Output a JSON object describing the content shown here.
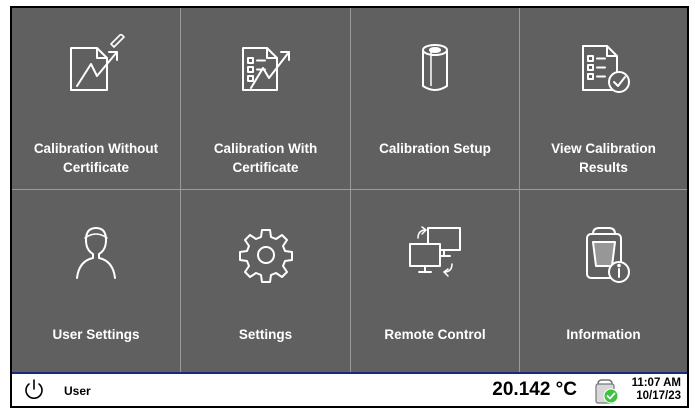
{
  "tiles": [
    {
      "label": "Calibration Without\nCertificate",
      "icon": "calibration-without-certificate-icon"
    },
    {
      "label": "Calibration With\nCertificate",
      "icon": "calibration-with-certificate-icon"
    },
    {
      "label": "Calibration Setup",
      "icon": "calibration-setup-icon"
    },
    {
      "label": "View Calibration\nResults",
      "icon": "view-calibration-results-icon"
    },
    {
      "label": "User Settings",
      "icon": "user-settings-icon"
    },
    {
      "label": "Settings",
      "icon": "settings-gear-icon"
    },
    {
      "label": "Remote Control",
      "icon": "remote-control-icon"
    },
    {
      "label": "Information",
      "icon": "information-icon"
    }
  ],
  "status": {
    "user": "User",
    "temperature": "20.142 °C",
    "time": "11:07 AM",
    "date": "10/17/23"
  },
  "colors": {
    "tile_bg": "#606060",
    "divider": "#9a9a9a",
    "status_border": "#1a2a7a",
    "ok_badge": "#3cc43c"
  }
}
